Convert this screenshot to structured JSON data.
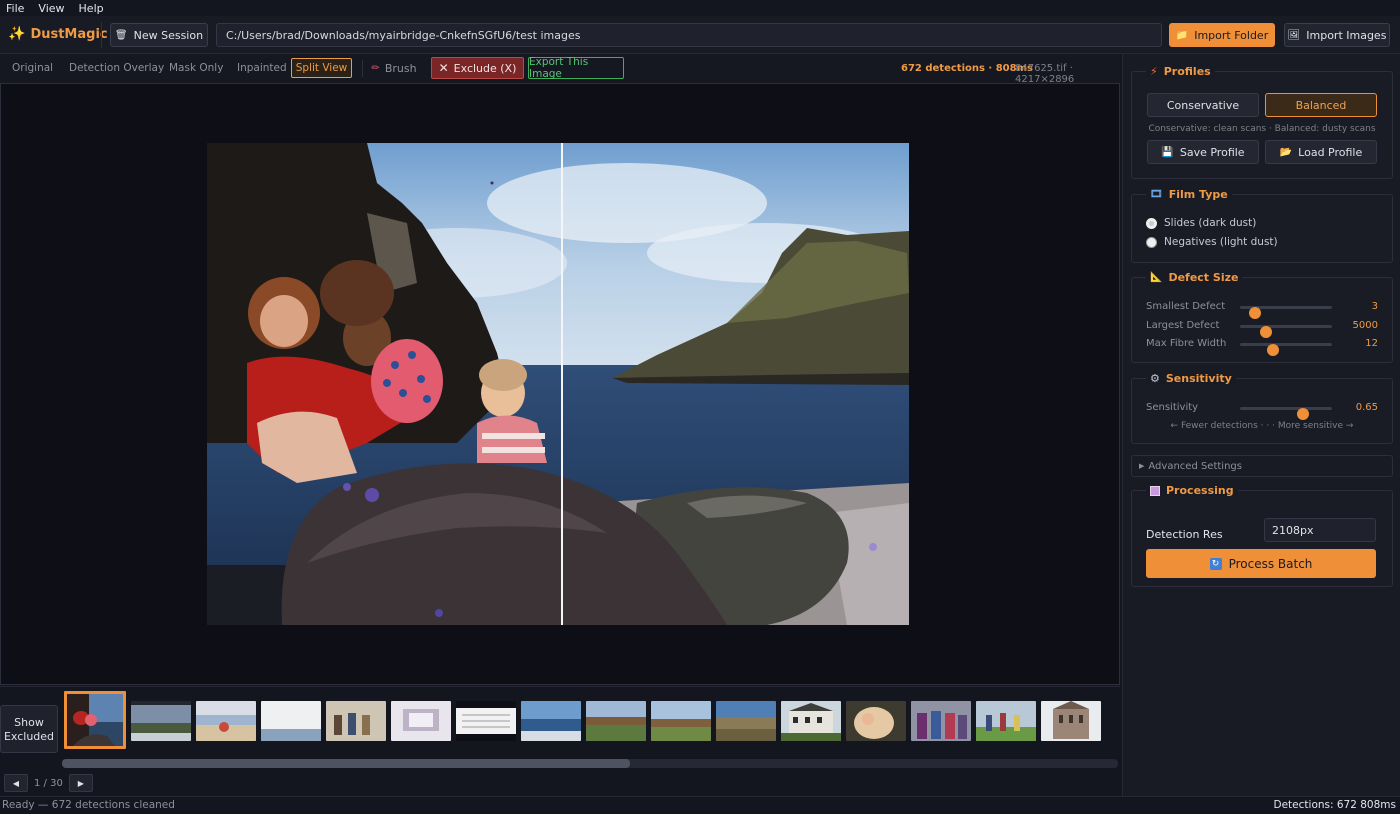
{
  "menu": [
    "File",
    "View",
    "Help"
  ],
  "app": {
    "name": "DustMagic"
  },
  "topbar": {
    "new_session": "New Session",
    "path": "C:/Users/brad/Downloads/myairbridge-CnkefnSGfU6/test images",
    "import_folder": "Import Folder",
    "import_images": "Import Images"
  },
  "viewbar": {
    "tabs": [
      "Original",
      "Detection Overlay",
      "Mask Only",
      "Inpainted"
    ],
    "active_tab": "Split View",
    "brush": "Brush",
    "exclude": "Exclude (X)",
    "export": "Export This Image",
    "detections_stat": "672 detections · 808ms",
    "file_info": "847625.tif · 4217×2896"
  },
  "filmstrip": {
    "show_excluded": "Show Excluded",
    "page": "1 / 30"
  },
  "status": {
    "left": "Ready — 672 detections cleaned",
    "right": "Detections: 672  808ms"
  },
  "panel": {
    "profiles": {
      "title": "Profiles",
      "conservative": "Conservative",
      "balanced": "Balanced",
      "hint": "Conservative: clean scans · Balanced: dusty scans",
      "save": "Save Profile",
      "load": "Load Profile"
    },
    "film_type": {
      "title": "Film Type",
      "options": [
        "Slides (dark dust)",
        "Negatives (light dust)"
      ],
      "selected": 0
    },
    "defect_size": {
      "title": "Defect Size",
      "sliders": [
        {
          "label": "Smallest Defect",
          "value": "3",
          "fraction": 0.16
        },
        {
          "label": "Largest Defect",
          "value": "5000",
          "fraction": 0.28
        },
        {
          "label": "Max Fibre Width",
          "value": "12",
          "fraction": 0.36
        }
      ]
    },
    "sensitivity": {
      "title": "Sensitivity",
      "label": "Sensitivity",
      "value": "0.65",
      "fraction": 0.68,
      "hint": "← Fewer detections · · · More sensitive →"
    },
    "advanced": "Advanced Settings",
    "processing": {
      "title": "Processing",
      "res_label": "Detection Res",
      "res_value": "2108px",
      "process": "Process Batch"
    }
  },
  "colors": {
    "accent": "#ef8f38",
    "exclude_bg": "#7a2626",
    "export_border": "#3fae5c"
  }
}
